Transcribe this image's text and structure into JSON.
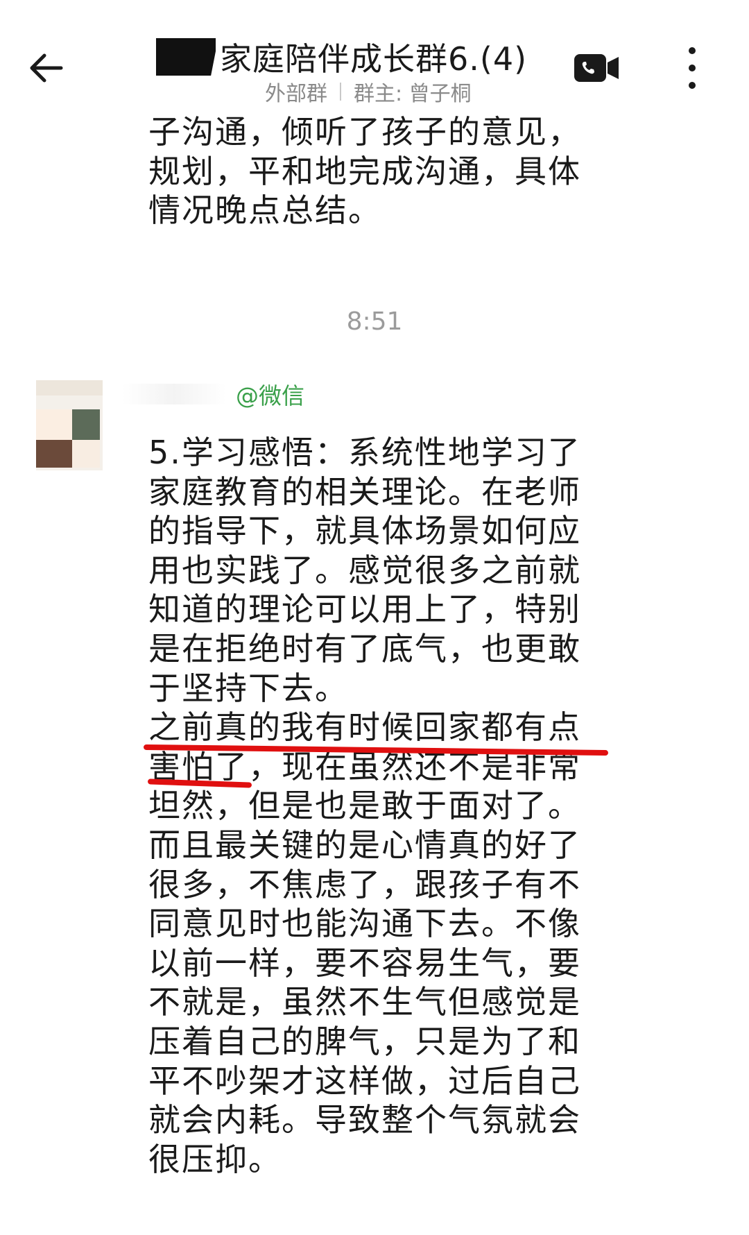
{
  "header": {
    "back_icon": "arrow-left-icon",
    "title": "家庭陪伴成长群6.(4)",
    "group_type": "外部群",
    "owner": "群主: 曾子桐",
    "video_icon": "video-call-icon",
    "more_icon": "more-vertical-icon"
  },
  "messages": {
    "previous_text": "子沟通，倾听了孩子的意见，规划，平和地完成沟通，具体情况晚点总结。",
    "timestamp": "8:51",
    "sender_source": "@微信",
    "main_text": "5.学习感悟：系统性地学习了家庭教育的相关理论。在老师的指导下，就具体场景如何应用也实践了。感觉很多之前就知道的理论可以用上了，特别是在拒绝时有了底气，也更敢于坚持下去。\n之前真的我有时候回家都有点害怕了，现在虽然还不是非常坦然，但是也是敢于面对了。而且最关键的是心情真的好了很多，不焦虑了，跟孩子有不同意见时也能沟通下去。不像以前一样，要不容易生气，要不就是，虽然不生气但感觉是压着自己的脾气，只是为了和平不吵架才这样做，过后自己就会内耗。导致整个气氛就会很压抑。"
  },
  "colors": {
    "accent_green": "#3aa04a",
    "underline_red": "#e01010",
    "timestamp_gray": "#9b9b9b"
  }
}
